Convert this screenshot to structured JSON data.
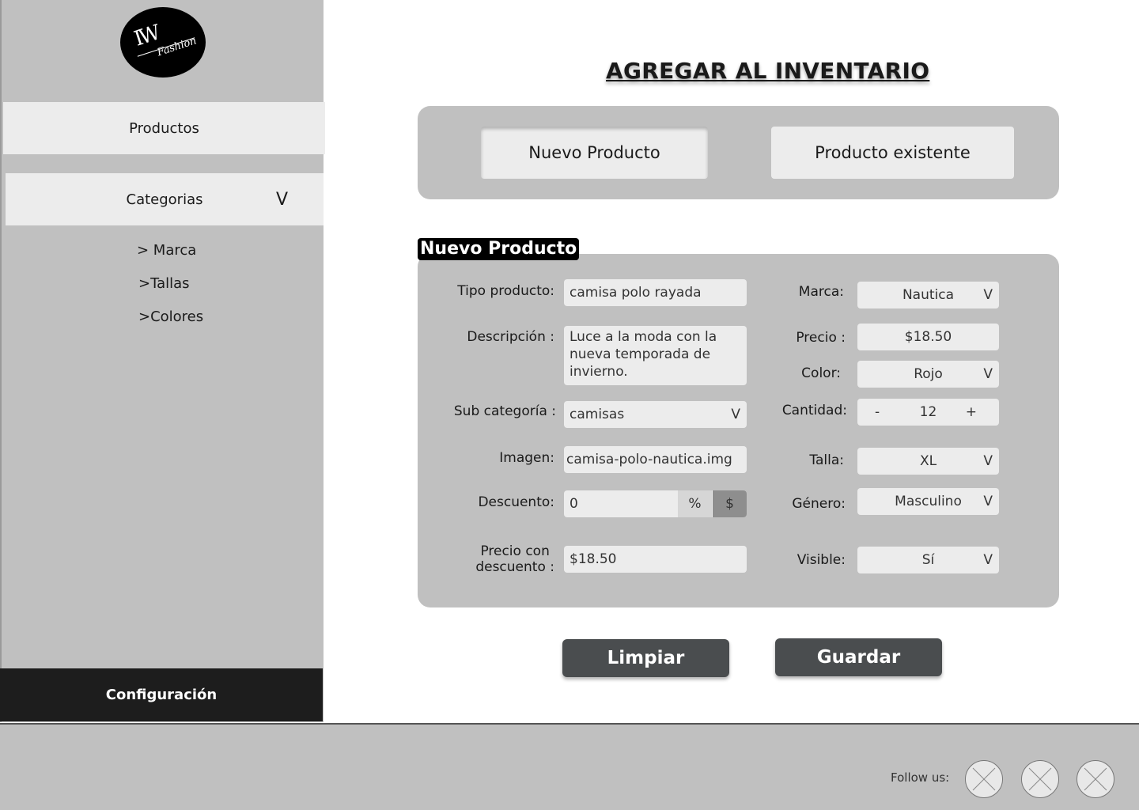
{
  "brand": {
    "logo_mark": "IW",
    "logo_text": "Fashion"
  },
  "sidebar": {
    "productos": "Productos",
    "categorias": "Categorias",
    "categorias_chevron": "V",
    "sub_items": [
      "> Marca",
      ">Tallas",
      ">Colores"
    ],
    "config": "Configuración"
  },
  "page": {
    "title": "AGREGAR AL INVENTARIO"
  },
  "mode": {
    "new_label": "Nuevo Producto",
    "existing_label": "Producto existente",
    "active": "new"
  },
  "form": {
    "title": "Nuevo Producto",
    "tipo_label": "Tipo producto:",
    "tipo_value": "camisa polo rayada",
    "desc_label": "Descripción :",
    "desc_value": "Luce a la moda con la nueva temporada de invierno.",
    "subcat_label": "Sub categoría :",
    "subcat_value": "camisas",
    "imagen_label": "Imagen:",
    "imagen_value": "camisa-polo-nautica.img",
    "descuento_label": "Descuento:",
    "descuento_value": "0",
    "descuento_pct": "%",
    "descuento_usd": "$",
    "precio_desc_label_1": "Precio con",
    "precio_desc_label_2": "descuento :",
    "precio_desc_value": "$18.50",
    "marca_label": "Marca:",
    "marca_value": "Nautica",
    "precio_label": "Precio :",
    "precio_value": "$18.50",
    "color_label": "Color:",
    "color_value": "Rojo",
    "cantidad_label": "Cantidad:",
    "cantidad_minus": "-",
    "cantidad_value": "12",
    "cantidad_plus": "+",
    "talla_label": "Talla:",
    "talla_value": "XL",
    "genero_label": "Género:",
    "genero_value": "Masculino",
    "visible_label": "Visible:",
    "visible_value": "Sí",
    "chevron": "V"
  },
  "actions": {
    "clear": "Limpiar",
    "save": "Guardar"
  },
  "footer": {
    "follow": "Follow us:",
    "social_icons": [
      "placeholder-icon",
      "placeholder-icon",
      "placeholder-icon"
    ]
  },
  "colors": {
    "panel": "#c0c0c0",
    "field": "#ececec",
    "button_dark": "#4a4d4f",
    "sidebar_dark": "#1d1d1d"
  }
}
